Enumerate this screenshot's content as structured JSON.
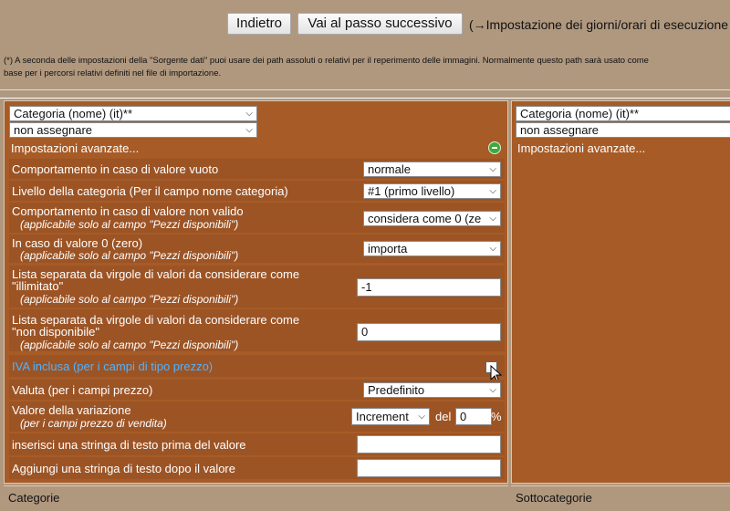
{
  "toolbar": {
    "back_label": "Indietro",
    "next_label": "Vai al passo successivo",
    "next_step": "(→Impostazione dei giorni/orari di esecuzione"
  },
  "note": {
    "line1": "(*) A seconda delle impostazioni della \"Sorgente dati\" puoi usare dei path assoluti o relativi per il reperimento delle immagini. Normalmente questo path sarà usato come",
    "line2": "base per i percorsi relativi definiti nel file di importazione."
  },
  "left": {
    "field_select": "Categoria (nome) (it)**",
    "assign_select": "non assegnare",
    "advanced": "Impostazioni avanzate...",
    "rows": {
      "empty_behavior": {
        "label": "Comportamento in caso di valore vuoto",
        "value": "normale"
      },
      "category_level": {
        "label": "Livello della categoria (Per il campo nome categoria)",
        "value": "#1 (primo livello)"
      },
      "invalid_behavior": {
        "label": "Comportamento in caso di valore non valido",
        "sub": "(applicabile solo al campo \"Pezzi disponibili\")",
        "value": "considera come 0 (ze"
      },
      "zero_value": {
        "label": "In caso di valore 0 (zero)",
        "sub": "(applicabile solo al campo \"Pezzi disponibili\")",
        "value": "importa"
      },
      "unlimited": {
        "label1": "Lista separata da virgole di valori da considerare come",
        "label2": "\"illimitato\"",
        "sub": "(applicabile solo al campo \"Pezzi disponibili\")",
        "value": "-1"
      },
      "unavailable": {
        "label1": "Lista separata da virgole di valori da considerare come",
        "label2": "\"non disponibile\"",
        "sub": "(applicabile solo al campo \"Pezzi disponibili\")",
        "value": "0"
      },
      "vat": {
        "label": "IVA inclusa (per i campi di tipo prezzo)",
        "checked": false
      },
      "currency": {
        "label": "Valuta (per i campi prezzo)",
        "value": "Predefinito"
      },
      "variation": {
        "label": "Valore della variazione",
        "sub": "(per i campi prezzo di vendita)",
        "mode": "Increment",
        "del_label": "del",
        "amount": "0",
        "unit": "%"
      },
      "prefix": {
        "label": "inserisci una stringa di testo prima del valore",
        "value": ""
      },
      "suffix": {
        "label": "Aggiungi una stringa di testo dopo il valore",
        "value": ""
      }
    },
    "footer": "Categorie"
  },
  "right": {
    "field_select": "Categoria (nome) (it)**",
    "assign_select": "non assegnare",
    "advanced": "Impostazioni avanzate...",
    "footer": "Sottocategorie"
  },
  "colors": {
    "panel": "#a75b26",
    "row": "#9c5425",
    "background": "#b0987f",
    "highlight": "#4fb3ff"
  }
}
